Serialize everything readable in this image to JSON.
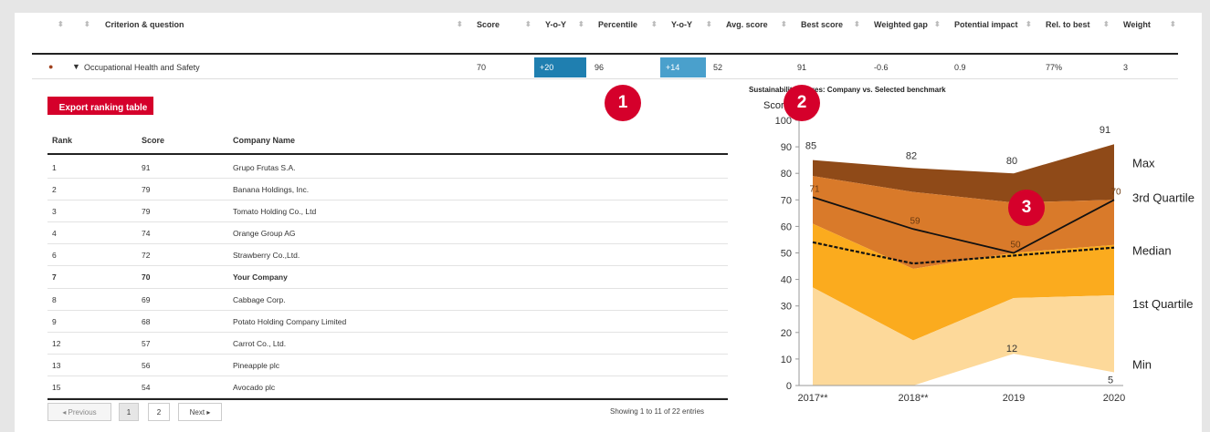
{
  "header": {
    "columns": [
      "Criterion & question",
      "Score",
      "Y-o-Y",
      "Percentile",
      "Y-o-Y",
      "Avg. score",
      "Best score",
      "Weighted gap",
      "Potential impact",
      "Rel. to best",
      "Weight"
    ]
  },
  "criterion_row": {
    "name": "Occupational Health and Safety",
    "score": "70",
    "score_yoy": "+20",
    "percentile": "96",
    "percentile_yoy": "+14",
    "avg_score": "52",
    "best_score": "91",
    "weighted_gap": "-0.6",
    "potential_impact": "0.9",
    "rel_to_best": "77%",
    "weight": "3",
    "colors": {
      "score_yoy_bg": "#1f7fb0",
      "percentile_yoy_bg": "#4aa0cc"
    }
  },
  "export_button": "Export ranking table",
  "ranking_table": {
    "headers": [
      "Rank",
      "Score",
      "Company Name"
    ],
    "rows": [
      {
        "rank": "1",
        "score": "91",
        "name": "Grupo Frutas S.A."
      },
      {
        "rank": "2",
        "score": "79",
        "name": "Banana Holdings, Inc."
      },
      {
        "rank": "3",
        "score": "79",
        "name": "Tomato Holding Co., Ltd"
      },
      {
        "rank": "4",
        "score": "74",
        "name": "Orange Group AG"
      },
      {
        "rank": "6",
        "score": "72",
        "name": "Strawberry Co.,Ltd."
      },
      {
        "rank": "7",
        "score": "70",
        "name": "Your Company"
      },
      {
        "rank": "8",
        "score": "69",
        "name": "Cabbage Corp."
      },
      {
        "rank": "9",
        "score": "68",
        "name": "Potato Holding Company Limited"
      },
      {
        "rank": "12",
        "score": "57",
        "name": "Carrot Co., Ltd."
      },
      {
        "rank": "13",
        "score": "56",
        "name": "Pineapple plc"
      },
      {
        "rank": "15",
        "score": "54",
        "name": "Avocado plc"
      }
    ]
  },
  "pagination": {
    "previous": "◂ Previous",
    "pages": [
      "1",
      "2"
    ],
    "next": "Next ▸",
    "showing": "Showing 1 to 11 of 22 entries"
  },
  "markers": [
    "1",
    "2",
    "3"
  ],
  "chart": {
    "title": "Sustainability Scores: Company vs. Selected benchmark",
    "ylabel": "Score",
    "colors": {
      "min_band": "#fdd99a",
      "q1_band": "#fbab1e",
      "median_band": "#f08c1a",
      "q3_band": "#d97a2a",
      "max_band": "#8f4a18"
    }
  },
  "chart_data": {
    "type": "area",
    "title": "Sustainability Scores: Company vs. Selected benchmark",
    "ylabel": "Score",
    "xlabel": "",
    "categories": [
      "2017**",
      "2018**",
      "2019",
      "2020"
    ],
    "ylim": [
      0,
      100
    ],
    "yticks": [
      0,
      10,
      20,
      30,
      40,
      50,
      60,
      70,
      80,
      90,
      100
    ],
    "series": [
      {
        "name": "Min",
        "values": [
          0,
          0,
          12,
          5
        ]
      },
      {
        "name": "1st Quartile",
        "values": [
          37,
          17,
          33,
          34
        ]
      },
      {
        "name": "Median",
        "values": [
          61,
          44,
          50,
          53
        ]
      },
      {
        "name": "3rd Quartile",
        "values": [
          79,
          73,
          69,
          70
        ]
      },
      {
        "name": "Max",
        "values": [
          85,
          82,
          80,
          91
        ]
      },
      {
        "name": "Company",
        "values": [
          71,
          59,
          50,
          70
        ]
      },
      {
        "name": "Benchmark median",
        "values": [
          54,
          46,
          49,
          52
        ]
      }
    ],
    "data_labels": {
      "max": [
        "85",
        "82",
        "80",
        "91"
      ],
      "company": [
        "71",
        "59",
        "50",
        "70"
      ],
      "min": [
        "12",
        "5"
      ]
    },
    "legend": [
      "Max",
      "3rd Quartile",
      "Median",
      "1st Quartile",
      "Min"
    ],
    "legend_position": "right"
  }
}
